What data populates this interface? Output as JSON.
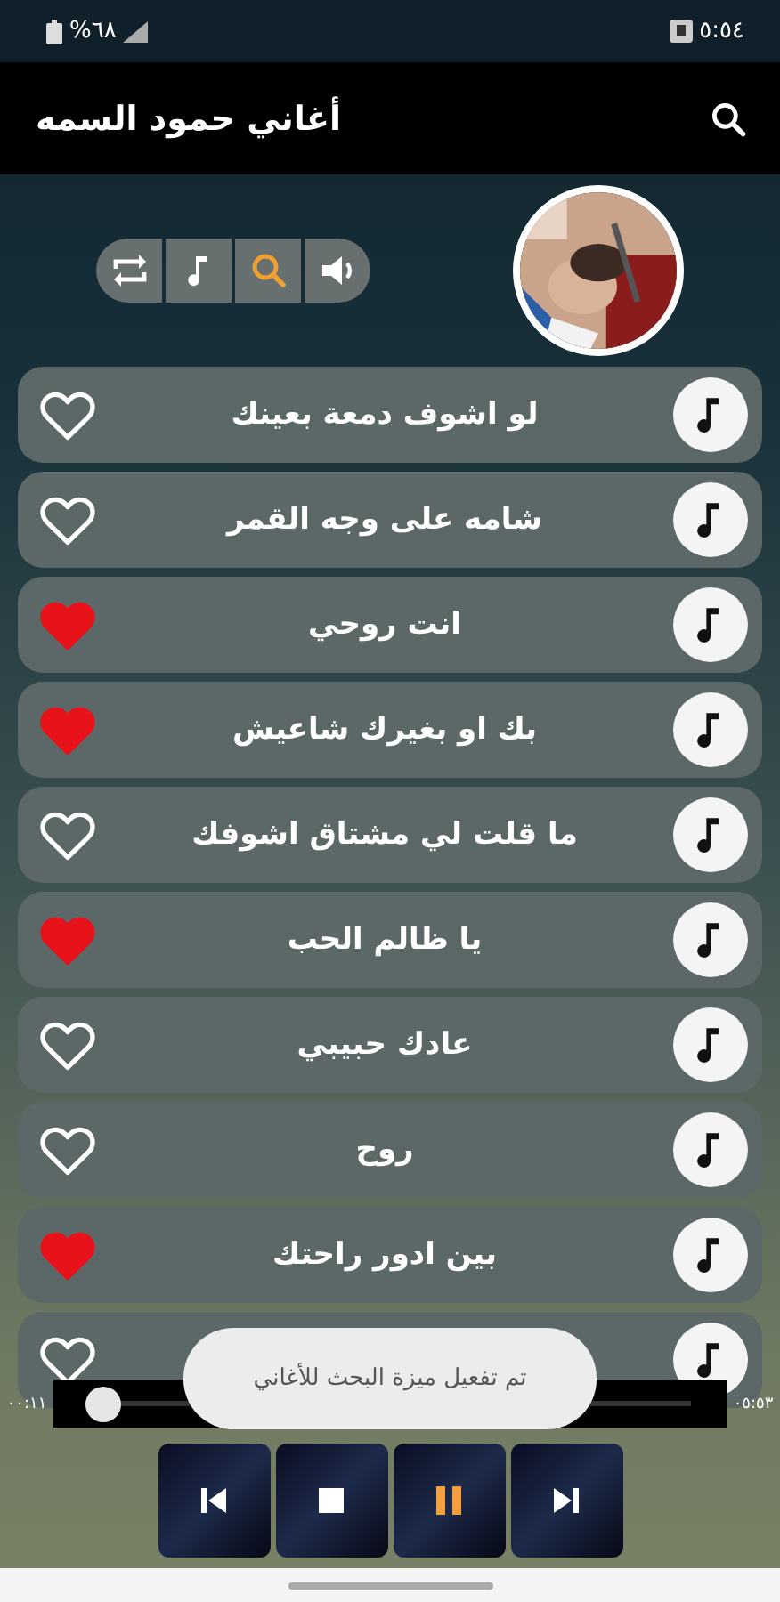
{
  "status_bar": {
    "battery": "%٦٨",
    "time": "٥:٥٤"
  },
  "app_bar": {
    "title": "أغاني حمود السمه"
  },
  "header": {
    "controls": [
      {
        "kind": "repeat",
        "active": false
      },
      {
        "kind": "note",
        "active": false
      },
      {
        "kind": "search",
        "active": true
      },
      {
        "kind": "volume",
        "active": false
      }
    ]
  },
  "songs": [
    {
      "title": "لو اشوف دمعة بعينك",
      "favorite": false
    },
    {
      "title": "شامه على وجه القمر",
      "favorite": false
    },
    {
      "title": "انت روحي",
      "favorite": true
    },
    {
      "title": "بك او بغيرك شاعيش",
      "favorite": true
    },
    {
      "title": "ما قلت لي مشتاق اشوفك",
      "favorite": false
    },
    {
      "title": "يا ظالم الحب",
      "favorite": true
    },
    {
      "title": "عادك حبيبي",
      "favorite": false
    },
    {
      "title": "روح",
      "favorite": false
    },
    {
      "title": "بين ادور راحتك",
      "favorite": true
    },
    {
      "favorite": false
    }
  ],
  "player": {
    "elapsed": "٠٠:١١",
    "remaining": "٠٥:٥٣",
    "level": 0.03,
    "buttons": [
      {
        "kind": "previous",
        "active": false
      },
      {
        "kind": "stop",
        "active": false
      },
      {
        "kind": "pause",
        "active": true
      },
      {
        "kind": "next",
        "active": false
      }
    ]
  },
  "toast": {
    "message": "تم تفعيل ميزة البحث للأغاني"
  }
}
